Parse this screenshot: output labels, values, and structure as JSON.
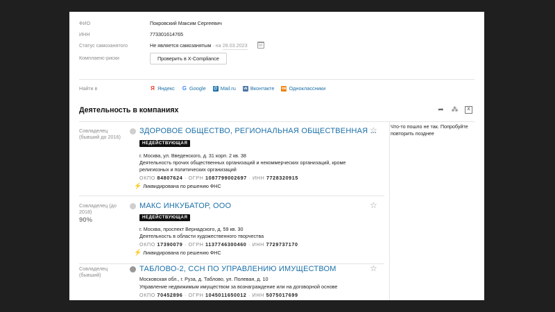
{
  "person": {
    "fio_label": "ФИО",
    "fio_value": "Покровский Максим Сергеевич",
    "inn_label": "ИНН",
    "inn_value": "773301614765",
    "status_label": "Статус самозанятого",
    "status_value": "Не является самозанятым",
    "status_sep": " · на ",
    "status_date": "28.03.2023",
    "compliance_label": "Комплаенс-риски",
    "compliance_button": "Проверить в X-Compliance"
  },
  "find_in": {
    "label": "Найти в",
    "links": [
      {
        "icon": "yandex-icon",
        "label": "Яндекс",
        "color": "#e8392c"
      },
      {
        "icon": "google-icon",
        "label": "Google",
        "color": "#4285f4"
      },
      {
        "icon": "mailru-icon",
        "label": "Mail.ru",
        "color": "#1a6fa8"
      },
      {
        "icon": "vk-icon",
        "label": "Вконтакте",
        "color": "#4c75a3"
      },
      {
        "icon": "ok-icon",
        "label": "Одноклассники",
        "color": "#ee8208"
      }
    ]
  },
  "section": {
    "title": "Деятельность в компаниях",
    "tools": [
      "share-icon",
      "graph-icon",
      "excel-icon"
    ]
  },
  "error_message": "Что-то пошло не так. Попробуйте повторить позднее",
  "companies": [
    {
      "role": "Совладелец (бывший до 2016)",
      "share": "",
      "name": "ЗДОРОВОЕ ОБЩЕСТВО, РЕГИОНАЛЬНАЯ ОБЩЕСТВЕННАЯ ...",
      "badge": "НЕДЕЙСТВУЮЩАЯ",
      "address": "г. Москва, ул. Введенского, д. 31 корп. 2 кв. 38",
      "activity": "Деятельность прочих общественных организаций и некоммерческих организаций, кроме религиозных и политических организаций",
      "okpo_label": "ОКПО",
      "okpo": "84807624",
      "ogrn_label": "ОГРН",
      "ogrn": "1087799002697",
      "inn_label": "ИНН",
      "inn": "7728320915",
      "liquidation": "Ликвидирована по решению ФНС"
    },
    {
      "role": "Совладелец (до 2018)",
      "share": "90%",
      "name": "МАКС ИНКУБАТОР, ООО",
      "badge": "НЕДЕЙСТВУЮЩАЯ",
      "address": "г. Москва, проспект Вернадского, д. 59 кв. 30",
      "activity": "Деятельность в области художественного творчества",
      "okpo_label": "ОКПО",
      "okpo": "17390079",
      "ogrn_label": "ОГРН",
      "ogrn": "1137746300460",
      "inn_label": "ИНН",
      "inn": "7729737170",
      "liquidation": "Ликвидирована по решению ФНС"
    },
    {
      "role": "Совладелец (бывший)",
      "share": "",
      "name": "ТАБЛОВО-2, ССН ПО УПРАВЛЕНИЮ ИМУЩЕСТВОМ",
      "badge": "",
      "address": "Московская обл., г. Руза, д. Таблово, ул. Полевая, д. 10",
      "activity": "Управление недвижимым имуществом за вознаграждение или на договорной основе",
      "okpo_label": "ОКПО",
      "okpo": "70452896",
      "ogrn_label": "ОГРН",
      "ogrn": "1045011650012",
      "inn_label": "ИНН",
      "inn": "5075017699",
      "liquidation": ""
    }
  ]
}
